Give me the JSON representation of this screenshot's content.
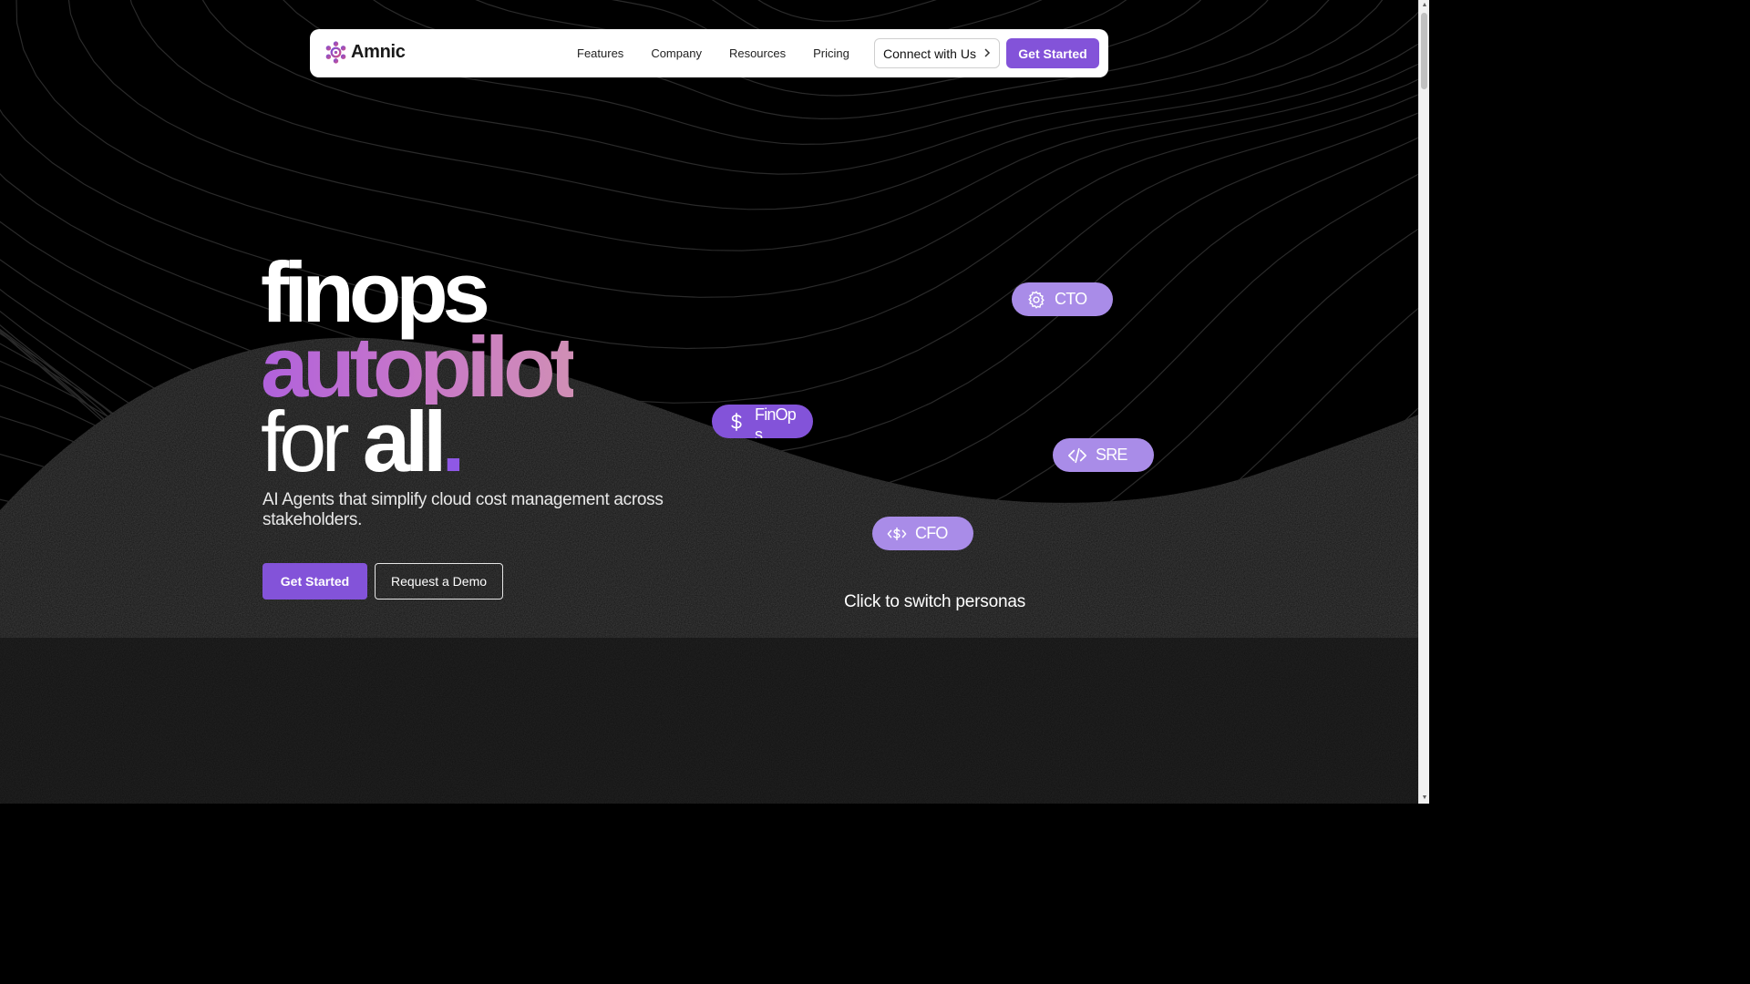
{
  "colors": {
    "accent": "#8353d9",
    "persona_inactive": "#a98ce8",
    "heading_gradient": [
      "#b061dc",
      "#d08fb5"
    ],
    "background": "#000000"
  },
  "navbar": {
    "brand": "Amnic",
    "links": [
      "Features",
      "Company",
      "Resources",
      "Pricing"
    ],
    "connect_label": "Connect with Us",
    "get_started_label": "Get Started"
  },
  "hero": {
    "line1": "finops",
    "line2": "autopilot",
    "line3_light": "for",
    "line3_bold": "all",
    "line3_dot": ".",
    "subtitle": "AI Agents that simplify cloud cost management across stakeholders.",
    "primary_cta": "Get Started",
    "secondary_cta": "Request a Demo"
  },
  "personas": [
    {
      "label": "CTO",
      "icon": "gear-icon",
      "active": false
    },
    {
      "label": "FinOps",
      "icon": "dollar-icon",
      "active": true
    },
    {
      "label": "SRE",
      "icon": "code-icon",
      "active": false
    },
    {
      "label": "CFO",
      "icon": "dollar-code-icon",
      "active": false
    }
  ],
  "switch_hint": "Click to switch personas"
}
